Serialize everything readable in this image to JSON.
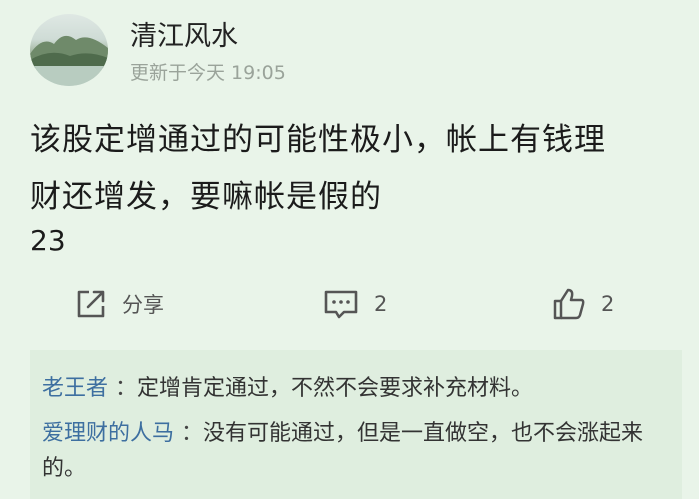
{
  "post": {
    "author": "清江风水",
    "timestamp": "更新于今天 19:05",
    "content_lines": [
      "该股定增通过的可能性极小，帐上有钱理",
      "财还增发，要嘛帐是假的"
    ],
    "number": "23"
  },
  "actions": {
    "share_label": "分享",
    "comment_count": "2",
    "like_count": "2"
  },
  "comments": [
    {
      "author": "老王者",
      "separator": " ：",
      "text": "定增肯定通过，不然不会要求补充材料。"
    },
    {
      "author": "爱理财的人马",
      "separator": " ：",
      "text": "没有可能通过，但是一直做空，也不会涨起来的。"
    }
  ],
  "colors": {
    "background": "#e9f4e9",
    "comment_background": "#dfeedf",
    "comment_author": "#3d6fa0",
    "meta_gray": "#9aa39a"
  },
  "icons": [
    "share-icon",
    "comment-icon",
    "thumbs-up-icon"
  ]
}
